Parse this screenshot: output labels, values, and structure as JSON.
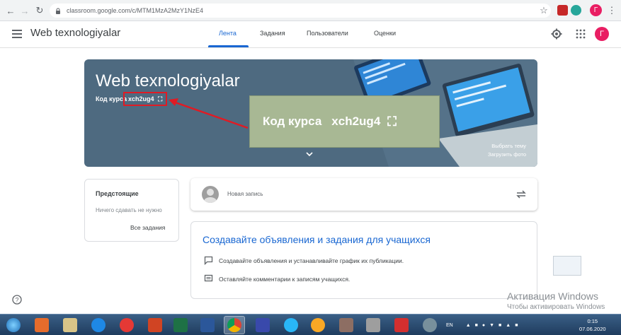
{
  "browser": {
    "url": "classroom.google.com/c/MTM1MzA2MzY1NzE4",
    "profile_initial": "Г"
  },
  "header": {
    "title": "Web texnologiyalar",
    "tabs": [
      "Лента",
      "Задания",
      "Пользователи",
      "Оценки"
    ],
    "active_tab": "Лента",
    "avatar_initial": "Г"
  },
  "banner": {
    "title": "Web texnologiyalar",
    "code_label": "Код курса",
    "code": "xch2ug4",
    "theme_link": "Выбрать тему",
    "upload_link": "Загрузить фото"
  },
  "callout": {
    "label": "Код курса",
    "code": "xch2ug4"
  },
  "upcoming": {
    "title": "Предстоящие",
    "empty_text": "Ничего сдавать не нужно",
    "all_link": "Все задания"
  },
  "new_post": {
    "placeholder": "Новая запись"
  },
  "info": {
    "title": "Создавайте объявления и задания для учащихся",
    "row1": "Создавайте объявления и устанавливайте график их публикации.",
    "row2": "Оставляйте комментарии к записям учащихся."
  },
  "watermark": {
    "line1": "Активация Windows",
    "line2": "Чтобы активировать Windows"
  },
  "taskbar": {
    "lang": "EN",
    "time": "0:15",
    "date": "07.06.2020"
  },
  "colors": {
    "accent": "#1967d2",
    "banner": "#4e6a80",
    "highlight": "#e01b24",
    "callout": "#a8b894"
  }
}
